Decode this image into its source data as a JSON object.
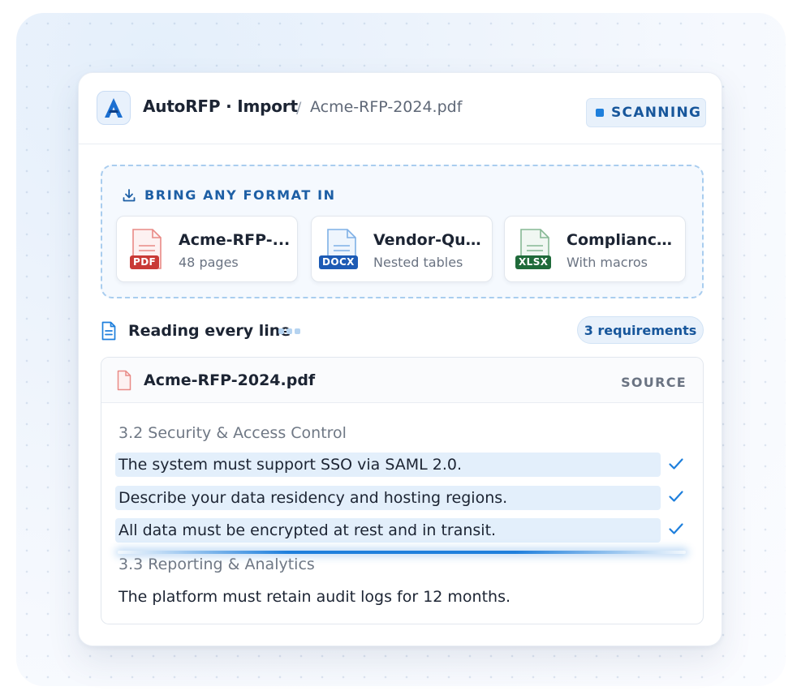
{
  "header": {
    "app_title": "AutoRFP · Import",
    "breadcrumb_sep": "/",
    "breadcrumb_file": "Acme-RFP-2024.pdf",
    "status": "SCANNING"
  },
  "import_zone": {
    "title": "BRING ANY FORMAT IN",
    "files": [
      {
        "name": "Acme-RFP-...",
        "meta": "48 pages",
        "type": "PDF",
        "icon": "pdf-file-icon",
        "color": "#c93a36",
        "tint": "#e98a86"
      },
      {
        "name": "Vendor-Que...",
        "meta": "Nested tables",
        "type": "DOCX",
        "icon": "docx-file-icon",
        "color": "#1d5bb5",
        "tint": "#7fb0e6"
      },
      {
        "name": "Compliance...",
        "meta": "With macros",
        "type": "XLSX",
        "icon": "xlsx-file-icon",
        "color": "#1f6a3a",
        "tint": "#86b894"
      }
    ]
  },
  "reading": {
    "label": "Reading every line",
    "requirements_count": "3 requirements"
  },
  "source": {
    "file_name": "Acme-RFP-2024.pdf",
    "label": "SOURCE",
    "section_1": "3.2 Security & Access Control",
    "requirements": [
      "The system must support SSO via SAML 2.0.",
      "Describe your data residency and hosting regions.",
      "All data must be encrypted at rest and in transit."
    ],
    "section_2": "3.3 Reporting & Analytics",
    "line_after": "The platform must retain audit logs for 12 months."
  },
  "colors": {
    "accent": "#1e7fdc",
    "accent_dark": "#17569b",
    "highlight": "#e3effb"
  }
}
